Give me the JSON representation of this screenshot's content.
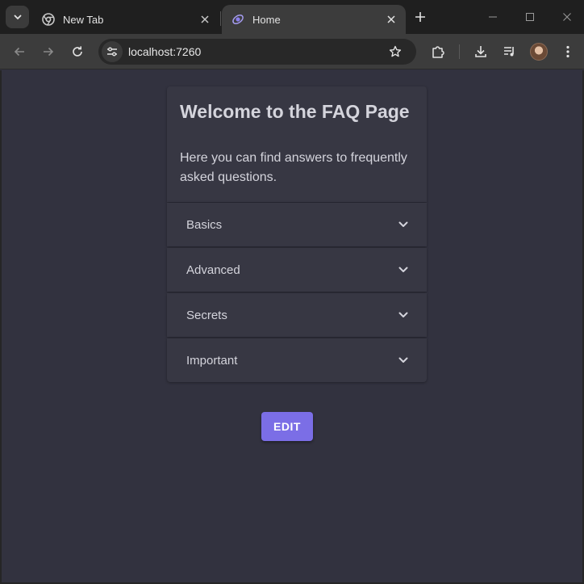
{
  "browser": {
    "tabs": [
      {
        "title": "New Tab"
      },
      {
        "title": "Home"
      }
    ],
    "url": "localhost:7260"
  },
  "page": {
    "title": "Welcome to the FAQ Page",
    "intro": "Here you can find answers to frequently asked questions.",
    "sections": [
      {
        "label": "Basics"
      },
      {
        "label": "Advanced"
      },
      {
        "label": "Secrets"
      },
      {
        "label": "Important"
      }
    ],
    "edit_label": "EDIT"
  },
  "colors": {
    "page_background": "#32323f",
    "card_background": "#373743",
    "accent": "#7b6ee6"
  }
}
